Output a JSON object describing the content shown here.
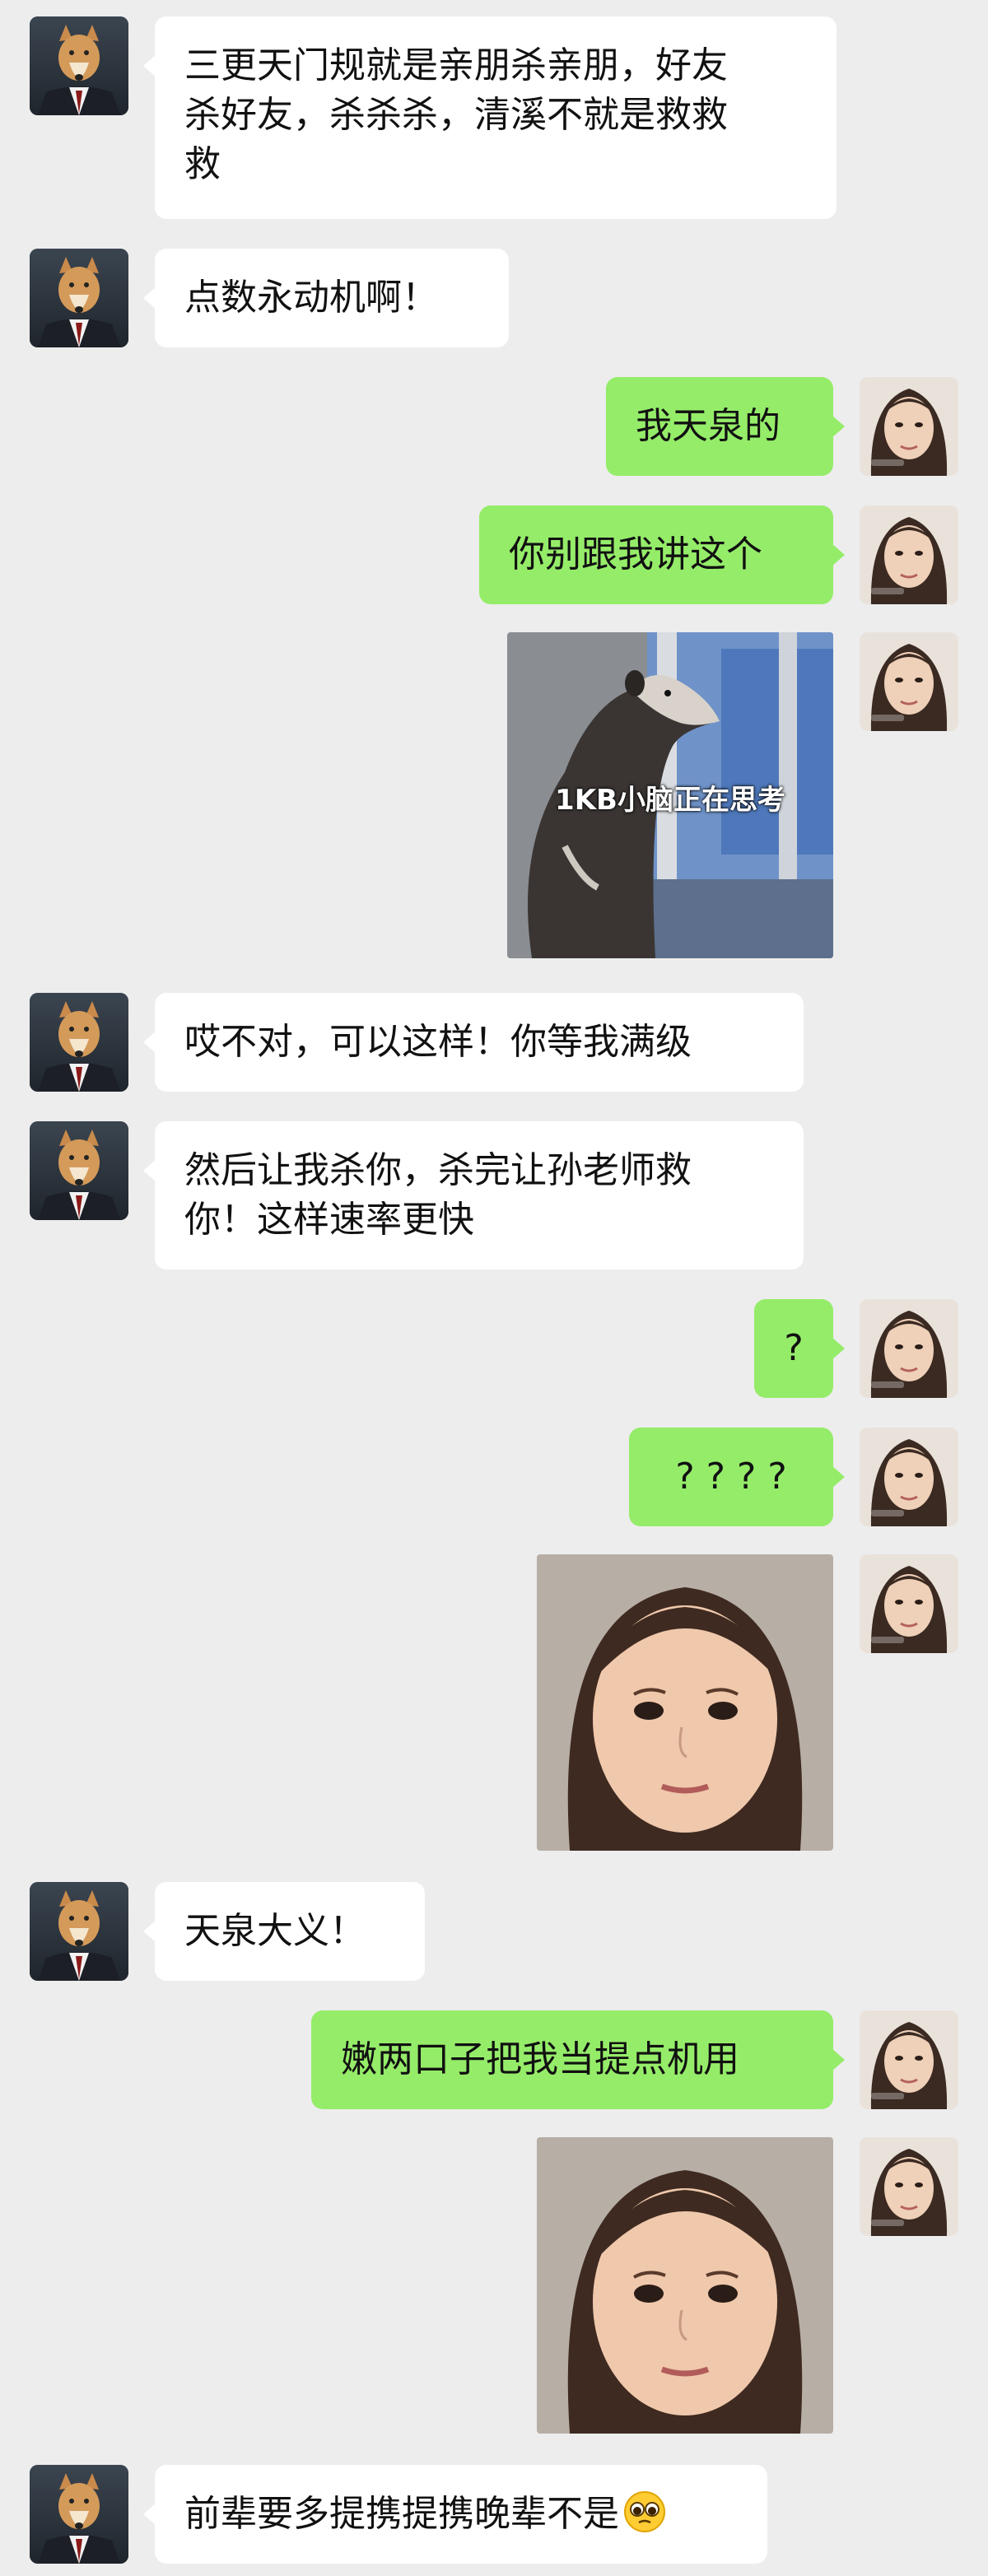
{
  "colors": {
    "background": "#ededed",
    "incoming_bubble": "#ffffff",
    "outgoing_bubble": "#95ec69"
  },
  "messages": [
    {
      "text": "三更天门规就是亲朋杀亲朋，好友\n杀好友，杀杀杀，清溪不就是救救\n救"
    },
    {
      "text": "点数永动机啊！"
    },
    {
      "text": "我天泉的"
    },
    {
      "text": "你别跟我讲这个"
    },
    {
      "image": "possum-meme",
      "caption": "1KB小脑正在思考"
    },
    {
      "text": "哎不对，可以这样！你等我满级"
    },
    {
      "text": "然后让我杀你，杀完让孙老师救\n你！这样速率更快"
    },
    {
      "text": "?"
    },
    {
      "text": "? ? ? ?"
    },
    {
      "image": "stunned-face-meme"
    },
    {
      "text": "天泉大义！"
    },
    {
      "text": "嫩两口子把我当提点机用"
    },
    {
      "image": "stunned-face-meme"
    },
    {
      "text": "前辈要多提携提携晚辈不是",
      "emoji": "pleading-face-emoji"
    }
  ]
}
